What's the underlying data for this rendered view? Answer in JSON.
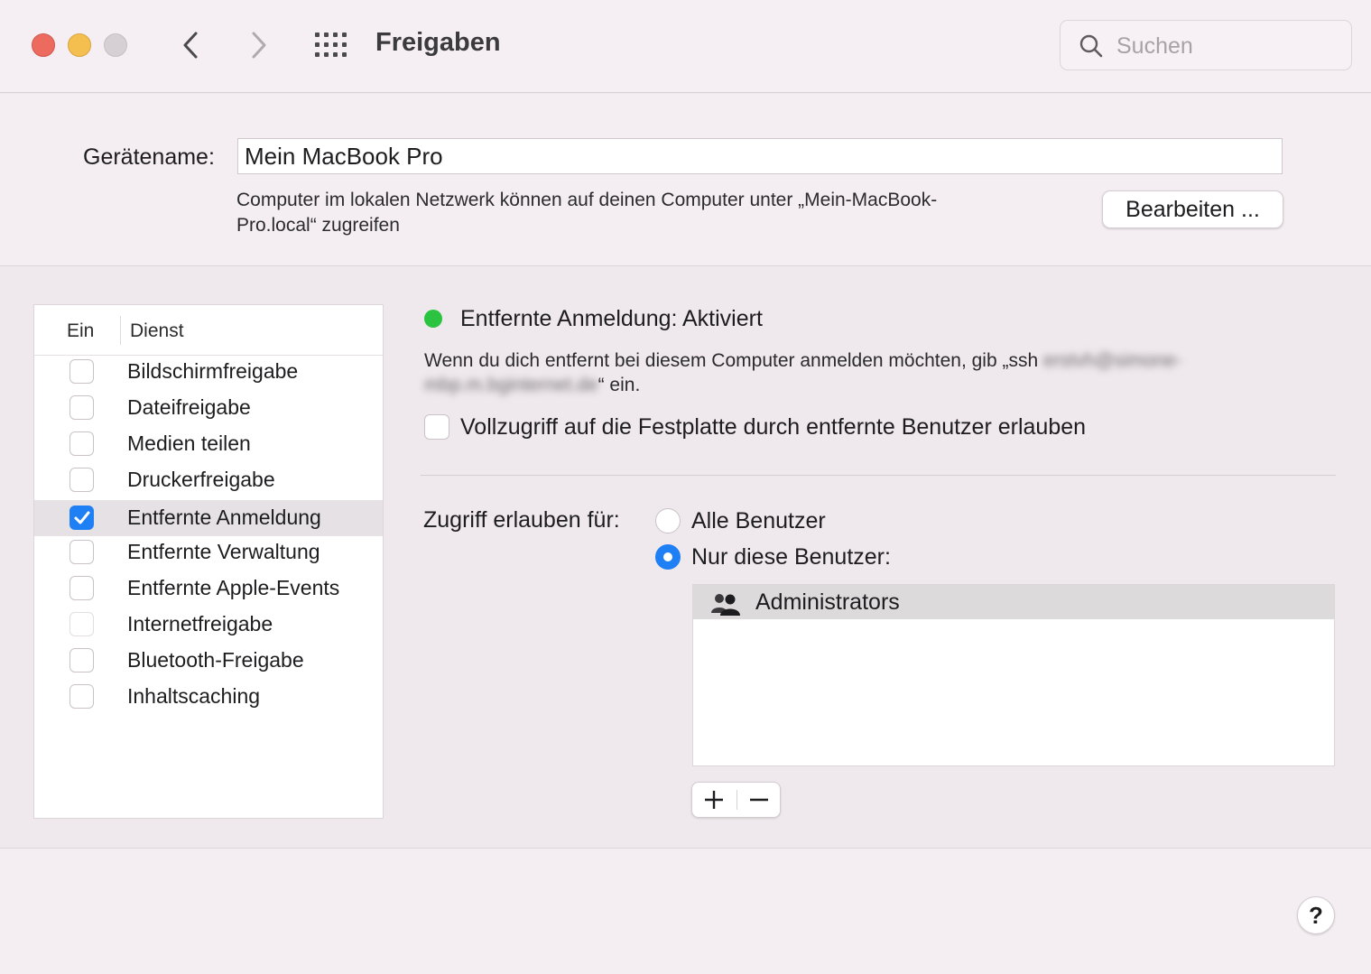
{
  "window": {
    "title": "Freigaben",
    "search_placeholder": "Suchen"
  },
  "device": {
    "label": "Gerätename:",
    "name": "Mein MacBook Pro",
    "info_line1": "Computer im lokalen Netzwerk können auf deinen Computer unter „Mein-MacBook-",
    "info_line2": "Pro.local“ zugreifen",
    "edit_button": "Bearbeiten ..."
  },
  "services": {
    "header_on": "Ein",
    "header_service": "Dienst",
    "items": [
      {
        "label": "Bildschirmfreigabe",
        "checked": false
      },
      {
        "label": "Dateifreigabe",
        "checked": false
      },
      {
        "label": "Medien teilen",
        "checked": false
      },
      {
        "label": "Druckerfreigabe",
        "checked": false
      },
      {
        "label": "Entfernte Anmeldung",
        "checked": true
      },
      {
        "label": "Entfernte Verwaltung",
        "checked": false
      },
      {
        "label": "Entfernte Apple-Events",
        "checked": false
      },
      {
        "label": "Internetfreigabe",
        "checked": false
      },
      {
        "label": "Bluetooth-Freigabe",
        "checked": false
      },
      {
        "label": "Inhaltscaching",
        "checked": false
      }
    ]
  },
  "detail": {
    "status": "Entfernte Anmeldung: Aktiviert",
    "status_color": "#2bc33f",
    "desc_prefix": "Wenn du dich entfernt bei diesem Computer anmelden möchten, gib „ssh ",
    "desc_blurred1": "erstvh@simone-",
    "desc_blurred2": "mbp.m.bginternet.de",
    "desc_suffix": "“ ein.",
    "full_access": "Vollzugriff auf die Festplatte durch entfernte Benutzer erlauben",
    "access_label": "Zugriff erlauben für:",
    "radio_all": "Alle Benutzer",
    "radio_only": "Nur diese Benutzer:",
    "users": [
      "Administrators"
    ]
  },
  "accent_color": "#1f7ff5"
}
